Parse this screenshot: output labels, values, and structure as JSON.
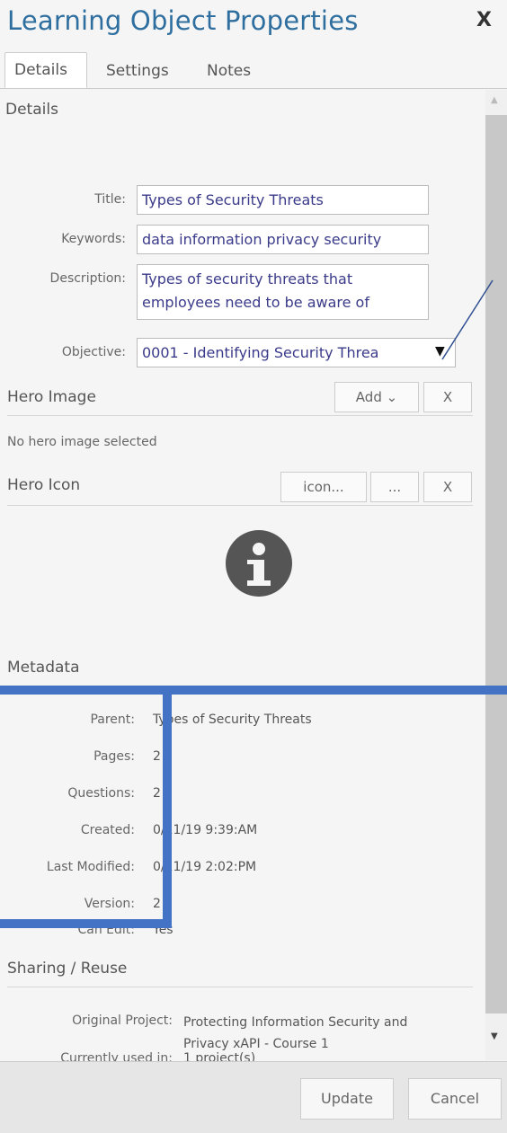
{
  "dialog": {
    "title": "Learning Object Properties",
    "close_label": "X"
  },
  "tabs": [
    {
      "label": "Details",
      "active": true
    },
    {
      "label": "Settings",
      "active": false
    },
    {
      "label": "Notes",
      "active": false
    }
  ],
  "details": {
    "header": "Details",
    "title_label": "Title:",
    "title_value": "Types of Security Threats",
    "keywords_label": "Keywords:",
    "keywords_value": "data information privacy security",
    "description_label": "Description:",
    "description_value": "Types of security threats that employees need to be aware of",
    "objective_label": "Objective:",
    "objective_value": "0001 - Identifying Security Threa"
  },
  "hero_image": {
    "header": "Hero Image",
    "add_label": "Add ⌄",
    "remove_label": "X",
    "status": "No hero image selected"
  },
  "hero_icon": {
    "header": "Hero Icon",
    "icon_label": "icon...",
    "browse_label": "...",
    "remove_label": "X",
    "icon_name": "info-icon"
  },
  "metadata": {
    "header": "Metadata",
    "rows": [
      {
        "label": "Parent:",
        "value": "Types of Security Threats"
      },
      {
        "label": "Pages:",
        "value": "2"
      },
      {
        "label": "Questions:",
        "value": "2"
      },
      {
        "label": "Created:",
        "value": "0/11/19 9:39:AM"
      },
      {
        "label": "Last Modified:",
        "value": "0/11/19 2:02:PM"
      },
      {
        "label": "Version:",
        "value": "2"
      },
      {
        "label": "Can Edit:",
        "value": "Yes"
      }
    ]
  },
  "sharing": {
    "header": "Sharing / Reuse",
    "original_project_label": "Original Project:",
    "original_project_value": "Protecting Information Security and Privacy xAPI - Course 1",
    "used_in_label": "Currently used in:",
    "used_in_value": "1 project(s)"
  },
  "footer": {
    "update_label": "Update",
    "cancel_label": "Cancel"
  },
  "colors": {
    "title": "#2f6f9f",
    "annotation": "#4472c4",
    "field_text": "#3a3a8a"
  }
}
